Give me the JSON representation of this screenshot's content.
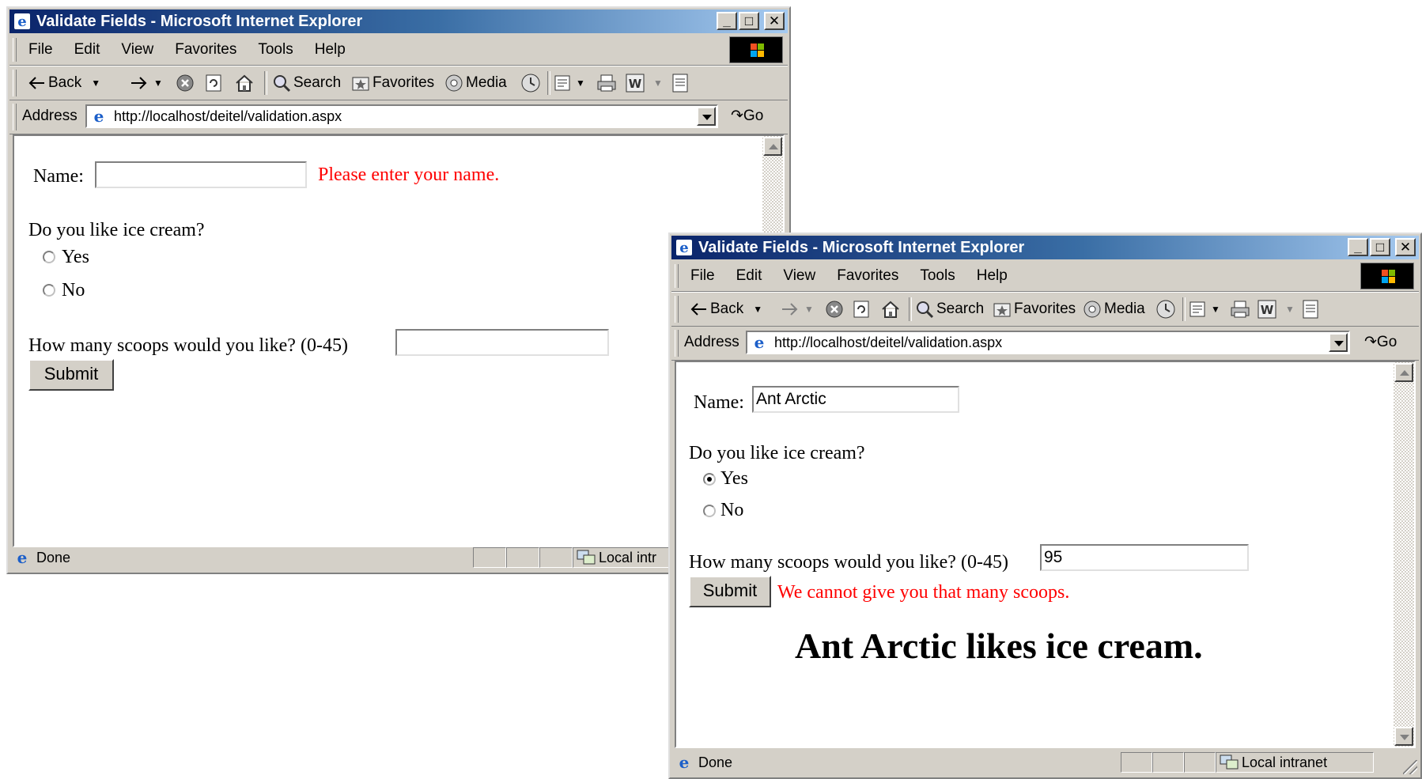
{
  "window_left": {
    "title": "Validate Fields - Microsoft Internet Explorer",
    "menu": [
      "File",
      "Edit",
      "View",
      "Favorites",
      "Tools",
      "Help"
    ],
    "toolbar": {
      "back": "Back",
      "search": "Search",
      "favorites": "Favorites",
      "media": "Media"
    },
    "address": {
      "label": "Address",
      "url": "http://localhost/deitel/validation.aspx",
      "go": "Go"
    },
    "form": {
      "name_label": "Name:",
      "name_value": "",
      "name_error": "Please enter your name.",
      "question": "Do you like ice cream?",
      "yes_label": "Yes",
      "yes_checked": false,
      "no_label": "No",
      "no_checked": false,
      "scoops_label": "How many scoops would you like? (0-45)",
      "scoops_value": "",
      "submit_label": "Submit"
    },
    "status": {
      "text": "Done",
      "zone": "Local intr"
    }
  },
  "window_right": {
    "title": "Validate Fields - Microsoft Internet Explorer",
    "menu": [
      "File",
      "Edit",
      "View",
      "Favorites",
      "Tools",
      "Help"
    ],
    "toolbar": {
      "back": "Back",
      "search": "Search",
      "favorites": "Favorites",
      "media": "Media"
    },
    "address": {
      "label": "Address",
      "url": "http://localhost/deitel/validation.aspx",
      "go": "Go"
    },
    "form": {
      "name_label": "Name:",
      "name_value": "Ant Arctic",
      "question": "Do you like ice cream?",
      "yes_label": "Yes",
      "yes_checked": true,
      "no_label": "No",
      "no_checked": false,
      "scoops_label": "How many scoops would you like? (0-45)",
      "scoops_value": "95",
      "submit_label": "Submit",
      "scoops_error": "We cannot give you that many scoops.",
      "result": "Ant Arctic likes ice cream."
    },
    "status": {
      "text": "Done",
      "zone": "Local intranet"
    }
  },
  "colors": {
    "error": "#ff0000",
    "titlebar_start": "#0a246a",
    "titlebar_end": "#a6caf0",
    "chrome": "#d4d0c8"
  },
  "icons": [
    "ie-logo-icon",
    "minimize-icon",
    "maximize-icon",
    "close-icon",
    "back-arrow-icon",
    "forward-arrow-icon",
    "stop-icon",
    "refresh-icon",
    "home-icon",
    "search-icon",
    "favorites-icon",
    "media-icon",
    "history-icon",
    "mail-icon",
    "print-icon",
    "edit-icon",
    "discuss-icon",
    "go-icon",
    "intranet-zone-icon",
    "windows-flag-icon"
  ]
}
